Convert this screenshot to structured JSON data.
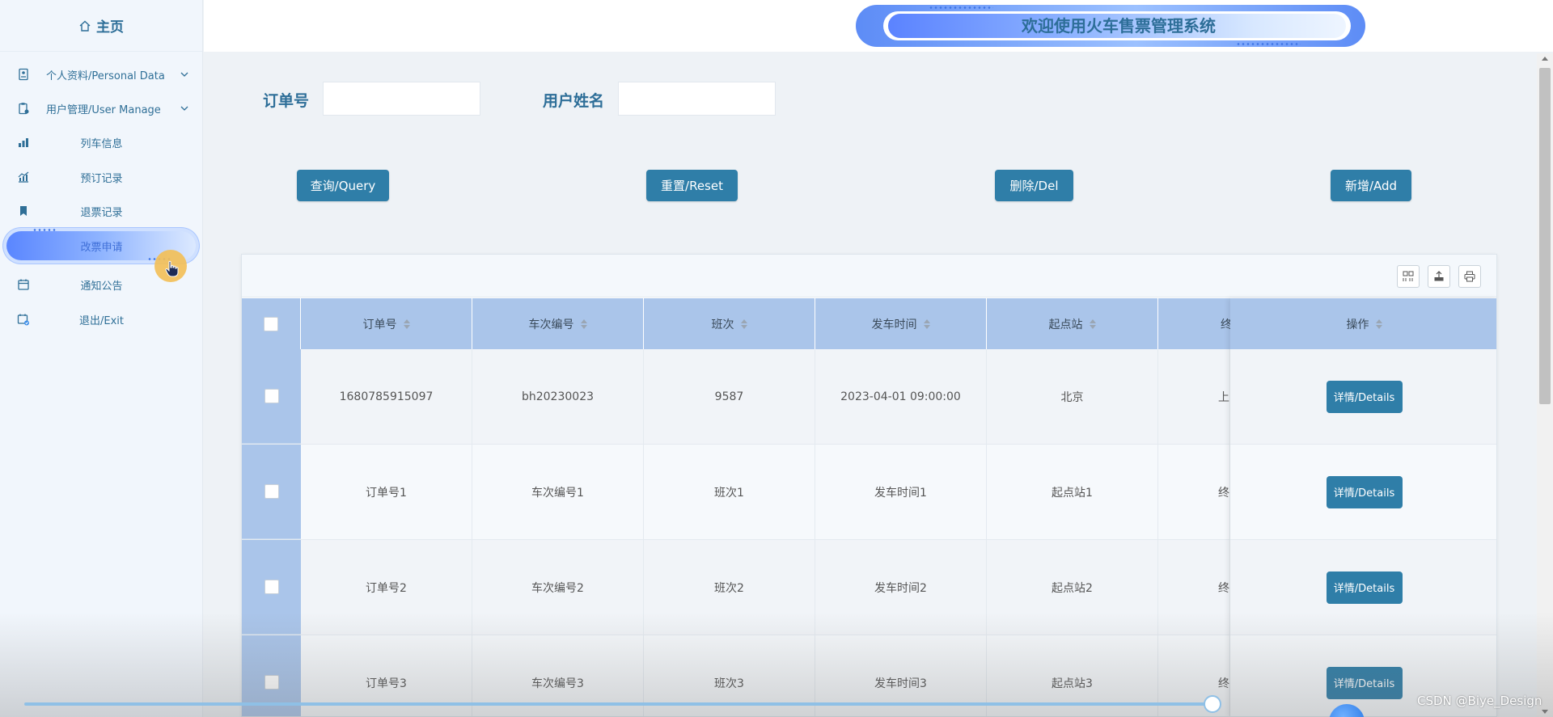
{
  "sidebar": {
    "home_label": "主页",
    "items": [
      {
        "label": "个人资料/Personal Data"
      },
      {
        "label": "用户管理/User Manage"
      },
      {
        "label": "列车信息"
      },
      {
        "label": "预订记录"
      },
      {
        "label": "退票记录"
      },
      {
        "label": "改票申请"
      },
      {
        "label": "通知公告"
      },
      {
        "label": "退出/Exit"
      }
    ]
  },
  "header": {
    "title": "欢迎使用火车售票管理系统"
  },
  "search": {
    "order_no_label": "订单号",
    "order_no_value": "",
    "user_name_label": "用户姓名",
    "user_name_value": ""
  },
  "buttons": {
    "query": "查询/Query",
    "reset": "重置/Reset",
    "delete": "删除/Del",
    "add": "新增/Add"
  },
  "table": {
    "columns": [
      "订单号",
      "车次编号",
      "班次",
      "发车时间",
      "起点站",
      "终"
    ],
    "action_column": "操作",
    "detail_label": "详情/Details",
    "rows": [
      [
        "1680785915097",
        "bh20230023",
        "9587",
        "2023-04-01 09:00:00",
        "北京",
        "上"
      ],
      [
        "订单号1",
        "车次编号1",
        "班次1",
        "发车时间1",
        "起点站1",
        "终"
      ],
      [
        "订单号2",
        "车次编号2",
        "班次2",
        "发车时间2",
        "起点站2",
        "终"
      ],
      [
        "订单号3",
        "车次编号3",
        "班次3",
        "发车时间3",
        "起点站3",
        "终"
      ]
    ]
  },
  "watermark": "CSDN @Biye_Design"
}
